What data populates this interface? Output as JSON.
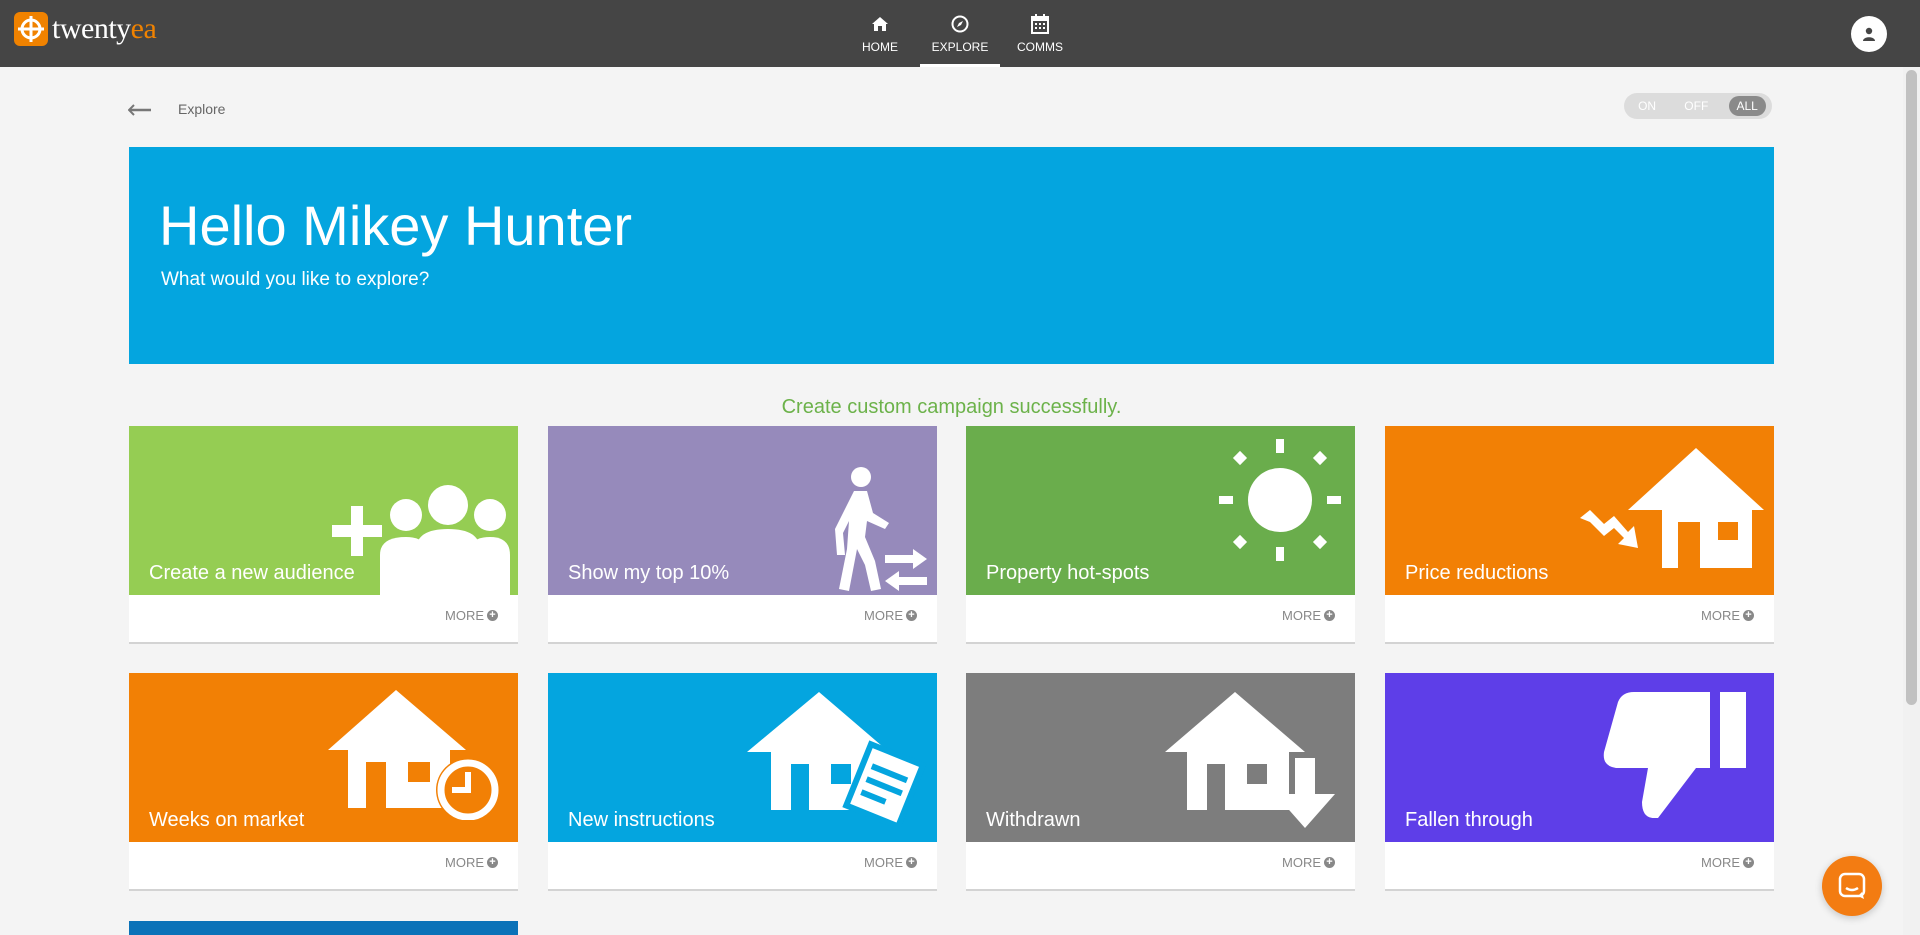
{
  "brand": {
    "name_part1": "twenty",
    "name_part2": "ea"
  },
  "nav": {
    "items": [
      {
        "label": "HOME",
        "icon": "home-icon"
      },
      {
        "label": "EXPLORE",
        "icon": "compass-icon",
        "active": true
      },
      {
        "label": "COMMS",
        "icon": "calendar-icon"
      }
    ]
  },
  "breadcrumb": {
    "label": "Explore"
  },
  "toggle": {
    "on": "ON",
    "off": "OFF",
    "all": "ALL",
    "selected": "ALL"
  },
  "hero": {
    "title": "Hello Mikey Hunter",
    "subtitle": "What would you like to explore?",
    "color": "#04a5df"
  },
  "status_message": "Create custom campaign successfully.",
  "tiles": [
    {
      "label": "Create a new audience",
      "more": "MORE",
      "color": "#95cd53",
      "icon": "add-audience-icon"
    },
    {
      "label": "Show my top 10%",
      "more": "MORE",
      "color": "#968abb",
      "icon": "walking-person-icon"
    },
    {
      "label": "Property hot-spots",
      "more": "MORE",
      "color": "#6aad4c",
      "icon": "sun-icon"
    },
    {
      "label": "Price reductions",
      "more": "MORE",
      "color": "#f28005",
      "icon": "house-price-down-icon"
    },
    {
      "label": "Weeks on market",
      "more": "MORE",
      "color": "#f28005",
      "icon": "house-clock-icon"
    },
    {
      "label": "New instructions",
      "more": "MORE",
      "color": "#04a5df",
      "icon": "house-document-icon"
    },
    {
      "label": "Withdrawn",
      "more": "MORE",
      "color": "#7d7d7d",
      "icon": "house-arrow-down-icon"
    },
    {
      "label": "Fallen through",
      "more": "MORE",
      "color": "#5e3ee8",
      "icon": "thumbs-down-icon"
    }
  ]
}
